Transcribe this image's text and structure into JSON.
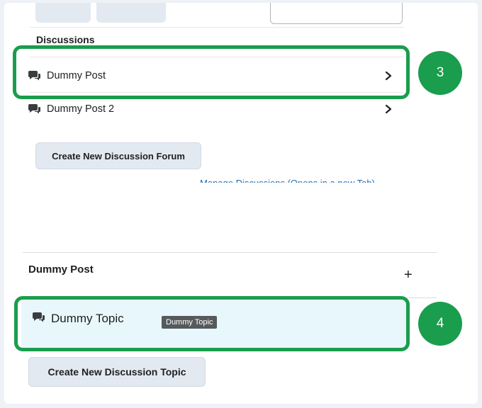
{
  "discussions": {
    "section_title": "Discussions",
    "rows": [
      {
        "label": "Dummy Post",
        "icon": "discussions-icon"
      },
      {
        "label": "Dummy Post 2",
        "icon": "discussions-icon"
      }
    ],
    "create_forum_label": "Create New Discussion Forum",
    "manage_link": "Manage Discussions (Opens in a new Tab)"
  },
  "forum": {
    "title": "Dummy Post",
    "add_symbol": "+",
    "topic_label": "Dummy Topic",
    "tooltip": "Dummy Topic",
    "create_topic_label": "Create New Discussion Topic"
  },
  "callouts": {
    "badge_3": "3",
    "badge_4": "4",
    "color": "#1a9d4d"
  }
}
